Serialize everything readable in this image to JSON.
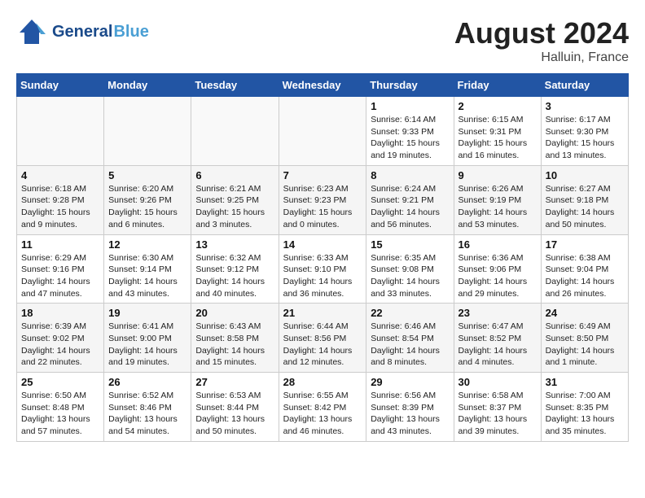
{
  "header": {
    "logo_general": "General",
    "logo_blue": "Blue",
    "month": "August 2024",
    "location": "Halluin, France"
  },
  "weekdays": [
    "Sunday",
    "Monday",
    "Tuesday",
    "Wednesday",
    "Thursday",
    "Friday",
    "Saturday"
  ],
  "weeks": [
    [
      {
        "day": "",
        "info": ""
      },
      {
        "day": "",
        "info": ""
      },
      {
        "day": "",
        "info": ""
      },
      {
        "day": "",
        "info": ""
      },
      {
        "day": "1",
        "info": "Sunrise: 6:14 AM\nSunset: 9:33 PM\nDaylight: 15 hours\nand 19 minutes."
      },
      {
        "day": "2",
        "info": "Sunrise: 6:15 AM\nSunset: 9:31 PM\nDaylight: 15 hours\nand 16 minutes."
      },
      {
        "day": "3",
        "info": "Sunrise: 6:17 AM\nSunset: 9:30 PM\nDaylight: 15 hours\nand 13 minutes."
      }
    ],
    [
      {
        "day": "4",
        "info": "Sunrise: 6:18 AM\nSunset: 9:28 PM\nDaylight: 15 hours\nand 9 minutes."
      },
      {
        "day": "5",
        "info": "Sunrise: 6:20 AM\nSunset: 9:26 PM\nDaylight: 15 hours\nand 6 minutes."
      },
      {
        "day": "6",
        "info": "Sunrise: 6:21 AM\nSunset: 9:25 PM\nDaylight: 15 hours\nand 3 minutes."
      },
      {
        "day": "7",
        "info": "Sunrise: 6:23 AM\nSunset: 9:23 PM\nDaylight: 15 hours\nand 0 minutes."
      },
      {
        "day": "8",
        "info": "Sunrise: 6:24 AM\nSunset: 9:21 PM\nDaylight: 14 hours\nand 56 minutes."
      },
      {
        "day": "9",
        "info": "Sunrise: 6:26 AM\nSunset: 9:19 PM\nDaylight: 14 hours\nand 53 minutes."
      },
      {
        "day": "10",
        "info": "Sunrise: 6:27 AM\nSunset: 9:18 PM\nDaylight: 14 hours\nand 50 minutes."
      }
    ],
    [
      {
        "day": "11",
        "info": "Sunrise: 6:29 AM\nSunset: 9:16 PM\nDaylight: 14 hours\nand 47 minutes."
      },
      {
        "day": "12",
        "info": "Sunrise: 6:30 AM\nSunset: 9:14 PM\nDaylight: 14 hours\nand 43 minutes."
      },
      {
        "day": "13",
        "info": "Sunrise: 6:32 AM\nSunset: 9:12 PM\nDaylight: 14 hours\nand 40 minutes."
      },
      {
        "day": "14",
        "info": "Sunrise: 6:33 AM\nSunset: 9:10 PM\nDaylight: 14 hours\nand 36 minutes."
      },
      {
        "day": "15",
        "info": "Sunrise: 6:35 AM\nSunset: 9:08 PM\nDaylight: 14 hours\nand 33 minutes."
      },
      {
        "day": "16",
        "info": "Sunrise: 6:36 AM\nSunset: 9:06 PM\nDaylight: 14 hours\nand 29 minutes."
      },
      {
        "day": "17",
        "info": "Sunrise: 6:38 AM\nSunset: 9:04 PM\nDaylight: 14 hours\nand 26 minutes."
      }
    ],
    [
      {
        "day": "18",
        "info": "Sunrise: 6:39 AM\nSunset: 9:02 PM\nDaylight: 14 hours\nand 22 minutes."
      },
      {
        "day": "19",
        "info": "Sunrise: 6:41 AM\nSunset: 9:00 PM\nDaylight: 14 hours\nand 19 minutes."
      },
      {
        "day": "20",
        "info": "Sunrise: 6:43 AM\nSunset: 8:58 PM\nDaylight: 14 hours\nand 15 minutes."
      },
      {
        "day": "21",
        "info": "Sunrise: 6:44 AM\nSunset: 8:56 PM\nDaylight: 14 hours\nand 12 minutes."
      },
      {
        "day": "22",
        "info": "Sunrise: 6:46 AM\nSunset: 8:54 PM\nDaylight: 14 hours\nand 8 minutes."
      },
      {
        "day": "23",
        "info": "Sunrise: 6:47 AM\nSunset: 8:52 PM\nDaylight: 14 hours\nand 4 minutes."
      },
      {
        "day": "24",
        "info": "Sunrise: 6:49 AM\nSunset: 8:50 PM\nDaylight: 14 hours\nand 1 minute."
      }
    ],
    [
      {
        "day": "25",
        "info": "Sunrise: 6:50 AM\nSunset: 8:48 PM\nDaylight: 13 hours\nand 57 minutes."
      },
      {
        "day": "26",
        "info": "Sunrise: 6:52 AM\nSunset: 8:46 PM\nDaylight: 13 hours\nand 54 minutes."
      },
      {
        "day": "27",
        "info": "Sunrise: 6:53 AM\nSunset: 8:44 PM\nDaylight: 13 hours\nand 50 minutes."
      },
      {
        "day": "28",
        "info": "Sunrise: 6:55 AM\nSunset: 8:42 PM\nDaylight: 13 hours\nand 46 minutes."
      },
      {
        "day": "29",
        "info": "Sunrise: 6:56 AM\nSunset: 8:39 PM\nDaylight: 13 hours\nand 43 minutes."
      },
      {
        "day": "30",
        "info": "Sunrise: 6:58 AM\nSunset: 8:37 PM\nDaylight: 13 hours\nand 39 minutes."
      },
      {
        "day": "31",
        "info": "Sunrise: 7:00 AM\nSunset: 8:35 PM\nDaylight: 13 hours\nand 35 minutes."
      }
    ]
  ]
}
